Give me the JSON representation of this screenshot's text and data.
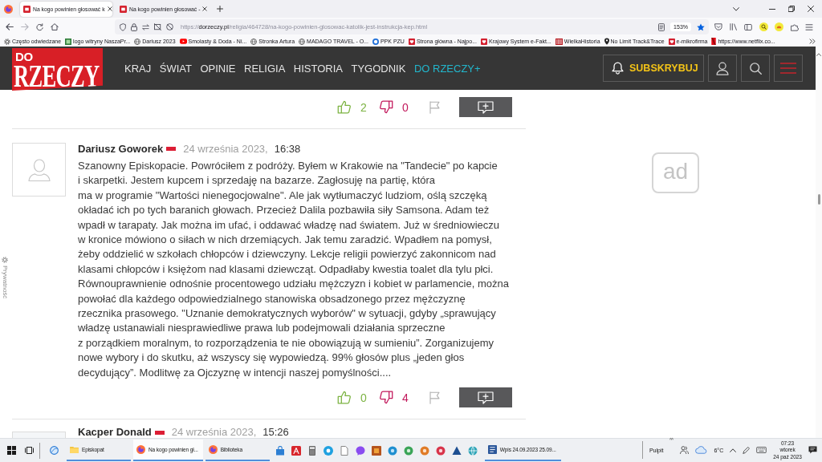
{
  "browser": {
    "tabs": [
      {
        "title": "Na kogo powinien głosować k",
        "selected": true
      },
      {
        "title": "Na kogo powinien głosować -",
        "selected": false
      }
    ],
    "url": "https://**dorzeczy.pl**/religia/464728/na-kogo-powinien-glosowac-katolik-jest-instrukcja-kep.html",
    "zoom": "153%",
    "bookmarked": true,
    "bookmarks": [
      {
        "label": "Często odwiedzane",
        "kind": "gear"
      },
      {
        "label": "logo witryny NaszaPr...",
        "kind": "tile"
      },
      {
        "label": "Dariusz 2023",
        "kind": "globe"
      },
      {
        "label": "Smolasty & Doda - Ni...",
        "kind": "video"
      },
      {
        "label": "Stronka Artura",
        "kind": "globe"
      },
      {
        "label": "MADAGO TRAVEL - O...",
        "kind": "globe"
      },
      {
        "label": "PPK PZU",
        "kind": "ring"
      },
      {
        "label": "Strona główna - Najpo...",
        "kind": "heart"
      },
      {
        "label": "Krajowy System e-Fakt...",
        "kind": "heart"
      },
      {
        "label": "WielkaHistoria",
        "kind": "stripes"
      },
      {
        "label": "No Limit Track&Trace",
        "kind": "pin"
      },
      {
        "label": "e-mikrofirma",
        "kind": "heart"
      },
      {
        "label": "https://www.netflix.co...",
        "kind": "ribbon"
      }
    ]
  },
  "site": {
    "logo_top": "DO",
    "logo_bottom": "RZECZY",
    "nav": [
      {
        "label": "KRAJ",
        "kind": "section"
      },
      {
        "label": "ŚWIAT",
        "kind": "section"
      },
      {
        "label": "OPINIE",
        "kind": "section"
      },
      {
        "label": "RELIGIA",
        "kind": "section"
      },
      {
        "label": "HISTORIA",
        "kind": "section"
      },
      {
        "label": "TYGODNIK",
        "kind": "section"
      },
      {
        "label": "DO RZECZY+",
        "kind": "premium"
      }
    ],
    "subscribe": "SUBSKRYBUJ"
  },
  "previous_comment": {
    "likes": "2",
    "dislikes": "0"
  },
  "comment": {
    "author": "Dariusz Goworek",
    "date": "24 września 2023,",
    "time": "16:38",
    "body": "Szanowny Episkopacie. Powróciłem z podróży. Byłem w Krakowie na \"Tandecie\" po kapcie\ni skarpetki. Jestem kupcem i sprzedaję na bazarze. Zagłosuję na partię, która\nma w programie \"Wartości nienegocjowalne\". Ale jak wytłumaczyć ludziom, oślą szczęką\nokładać ich po tych baranich głowach. Przecież Dalila pozbawiła siły Samsona. Adam też\nwpadł w tarapaty. Jak można im ufać, i oddawać władzę nad światem. Już w średniowieczu\nw kronice mówiono o siłach w nich drzemiących. Jak temu zaradzić. Wpadłem na pomysł,\nżeby oddzielić w szkołach chłopców i dziewczyny. Lekcje religii powierzyć zakonnicom nad\nklasami chłopców i księżom nad klasami dziewcząt. Odpadłaby kwestia toalet dla tylu płci.\nRównouprawnienie odnośnie procentowego udziału mężczyzn i kobiet w parlamencie, można\npowołać dla każdego odpowiedzialnego stanowiska obsadzonego przez mężczyznę\nrzecznika prasowego. \"Uznanie demokratycznych wyborów\" w sytuacji, gdyby „sprawujący\nwładzę ustanawiali niesprawiedliwe prawa lub podejmowali działania sprzeczne\nz porządkiem moralnym, to rozporządzenia te nie obowiązują w sumieniu”. Zorganizujemy\nnowe wybory i do skutku, aż wszyscy się wypowiedzą. 99% głosów plus „jeden głos\ndecydujący”. Modlitwę za Ojczyznę w intencji naszej pomyślności....",
    "likes": "0",
    "dislikes": "4"
  },
  "next_comment": {
    "author": "Kacper Donald",
    "date": "24 września 2023,",
    "time": "15:26"
  },
  "ad": {
    "label": "ad"
  },
  "privacy": {
    "label": "Prywatność"
  },
  "taskbar": {
    "windows": [
      {
        "label": "Episkopat",
        "kind": "folder",
        "selected": false
      },
      {
        "label": "Na kogo powinien gł...",
        "kind": "browser",
        "selected": true
      },
      {
        "label": "Biblioteka",
        "kind": "browser",
        "selected": false
      }
    ],
    "more_windows": [
      {
        "label": "Wpis 24.09.2023 25.09...",
        "kind": "document",
        "selected": false
      }
    ],
    "desktop": "Pulpit",
    "temperature": "6°C",
    "time": "07:23",
    "weekday": "wtorek",
    "date": "24 paź 2023"
  }
}
